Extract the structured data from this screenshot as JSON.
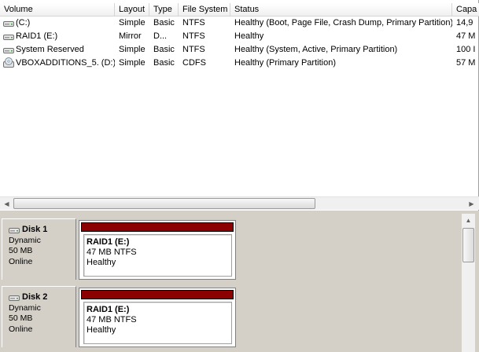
{
  "columns": [
    "Volume",
    "Layout",
    "Type",
    "File System",
    "Status",
    "Capa"
  ],
  "volumes": [
    {
      "name": "(C:)",
      "layout": "Simple",
      "type": "Basic",
      "fs": "NTFS",
      "status": "Healthy (Boot, Page File, Crash Dump, Primary Partition)",
      "capacity": "14,9",
      "icon": "drive-icon"
    },
    {
      "name": "RAID1 (E:)",
      "layout": "Mirror",
      "type": "D...",
      "fs": "NTFS",
      "status": "Healthy",
      "capacity": "47 M",
      "icon": "drive-icon"
    },
    {
      "name": "System Reserved",
      "layout": "Simple",
      "type": "Basic",
      "fs": "NTFS",
      "status": "Healthy (System, Active, Primary Partition)",
      "capacity": "100 I",
      "icon": "drive-icon"
    },
    {
      "name": "VBOXADDITIONS_5. (D:)",
      "layout": "Simple",
      "type": "Basic",
      "fs": "CDFS",
      "status": "Healthy (Primary Partition)",
      "capacity": "57 M",
      "icon": "cd-drive-icon"
    }
  ],
  "disks": [
    {
      "title": "Disk 1",
      "kind": "Dynamic",
      "size": "50 MB",
      "state": "Online",
      "partition": {
        "name": "RAID1  (E:)",
        "detail": "47 MB NTFS",
        "status": "Healthy",
        "bar_color": "#8b0000"
      }
    },
    {
      "title": "Disk 2",
      "kind": "Dynamic",
      "size": "50 MB",
      "state": "Online",
      "partition": {
        "name": "RAID1  (E:)",
        "detail": "47 MB NTFS",
        "status": "Healthy",
        "bar_color": "#8b0000"
      }
    }
  ]
}
